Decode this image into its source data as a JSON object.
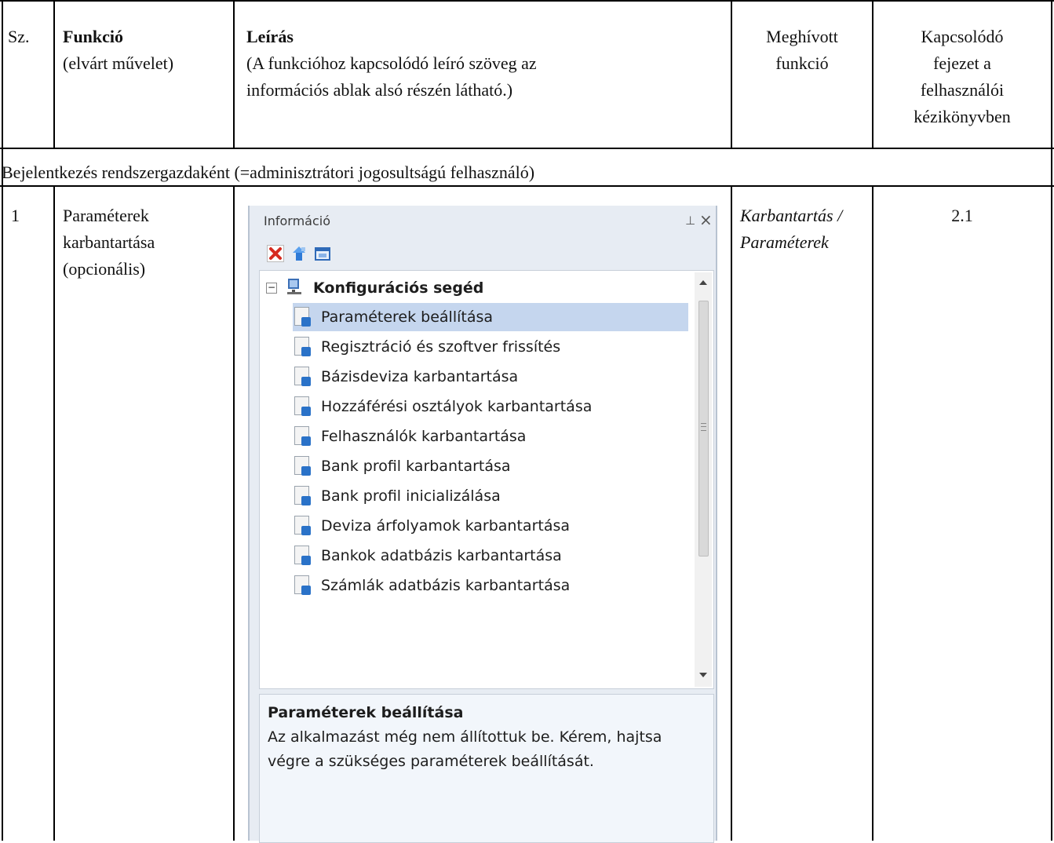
{
  "header": {
    "col1": "Sz.",
    "col2_title": "Funkció",
    "col2_sub": "(elvárt művelet)",
    "col3_title": "Leírás",
    "col3_sub_line1": "(A funkcióhoz kapcsolódó leíró szöveg az",
    "col3_sub_line2": "információs ablak alsó részén látható.)",
    "col4_line1": "Meghívott",
    "col4_line2": "funkció",
    "col5_line1": "Kapcsolódó",
    "col5_line2": "fejezet a",
    "col5_line3": "felhasználói",
    "col5_line4": "kézikönyvben"
  },
  "section_row": "Bejelentkezés rendszergazdaként  (=adminisztrátori jogosultságú felhasználó)",
  "row1": {
    "num": "1",
    "func_line1": "Paraméterek",
    "func_line2": "karbantartása",
    "func_line3": "(opcionális)",
    "called_line1": "Karbantartás /",
    "called_line2": "Paraméterek",
    "chapter": "2.1"
  },
  "info_panel": {
    "title": "Információ",
    "pin_glyph": "⊥",
    "close_glyph": "×",
    "expand_glyph": "−",
    "root_label": "Konfigurációs segéd",
    "items": [
      "Paraméterek beállítása",
      "Regisztráció és szoftver frissítés",
      "Bázisdeviza karbantartása",
      "Hozzáférési osztályok karbantartása",
      "Felhasználók karbantartása",
      "Bank profil karbantartása",
      "Bank profil inicializálása",
      "Deviza árfolyamok karbantartása",
      "Bankok adatbázis karbantartása",
      "Számlák adatbázis karbantartása"
    ],
    "selected_index": 0,
    "desc_title": "Paraméterek beállítása",
    "desc_line1": "Az alkalmazást még nem állítottuk be. Kérem, hajtsa",
    "desc_line2": "végre a szükséges paraméterek beállítását."
  }
}
